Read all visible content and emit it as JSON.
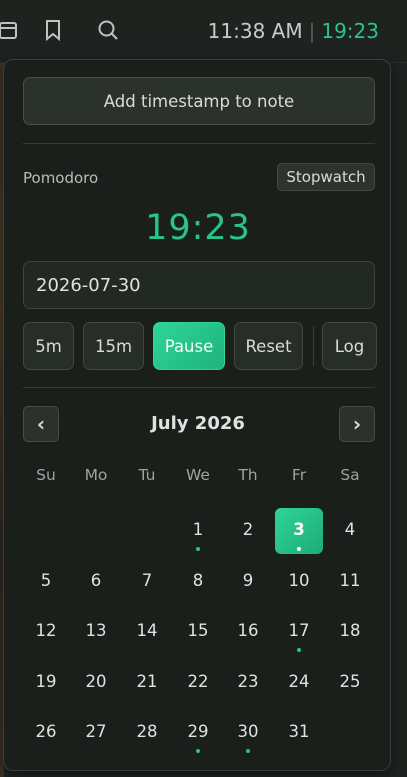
{
  "topbar": {
    "icons": [
      "calendar-icon",
      "bookmark-icon",
      "search-icon"
    ],
    "clock": "11:38 AM",
    "separator": "|",
    "timer": "19:23"
  },
  "panel": {
    "add_timestamp_label": "Add timestamp to note",
    "mode_label": "Pomodoro",
    "stopwatch_label": "Stopwatch",
    "timer_display": "19:23",
    "date_value": "2026-07-30",
    "controls": {
      "five_min": "5m",
      "fifteen_min": "15m",
      "pause": "Pause",
      "reset": "Reset",
      "log": "Log"
    }
  },
  "calendar": {
    "prev_label": "‹",
    "next_label": "›",
    "month_title": "July 2026",
    "weekdays": [
      "Su",
      "Mo",
      "Tu",
      "We",
      "Th",
      "Fr",
      "Sa"
    ],
    "first_weekday_index": 3,
    "days_in_month": 31,
    "selected_day": 3,
    "days_with_entries": [
      1,
      3,
      17,
      29,
      30
    ],
    "accent_color": "#27c48c"
  }
}
